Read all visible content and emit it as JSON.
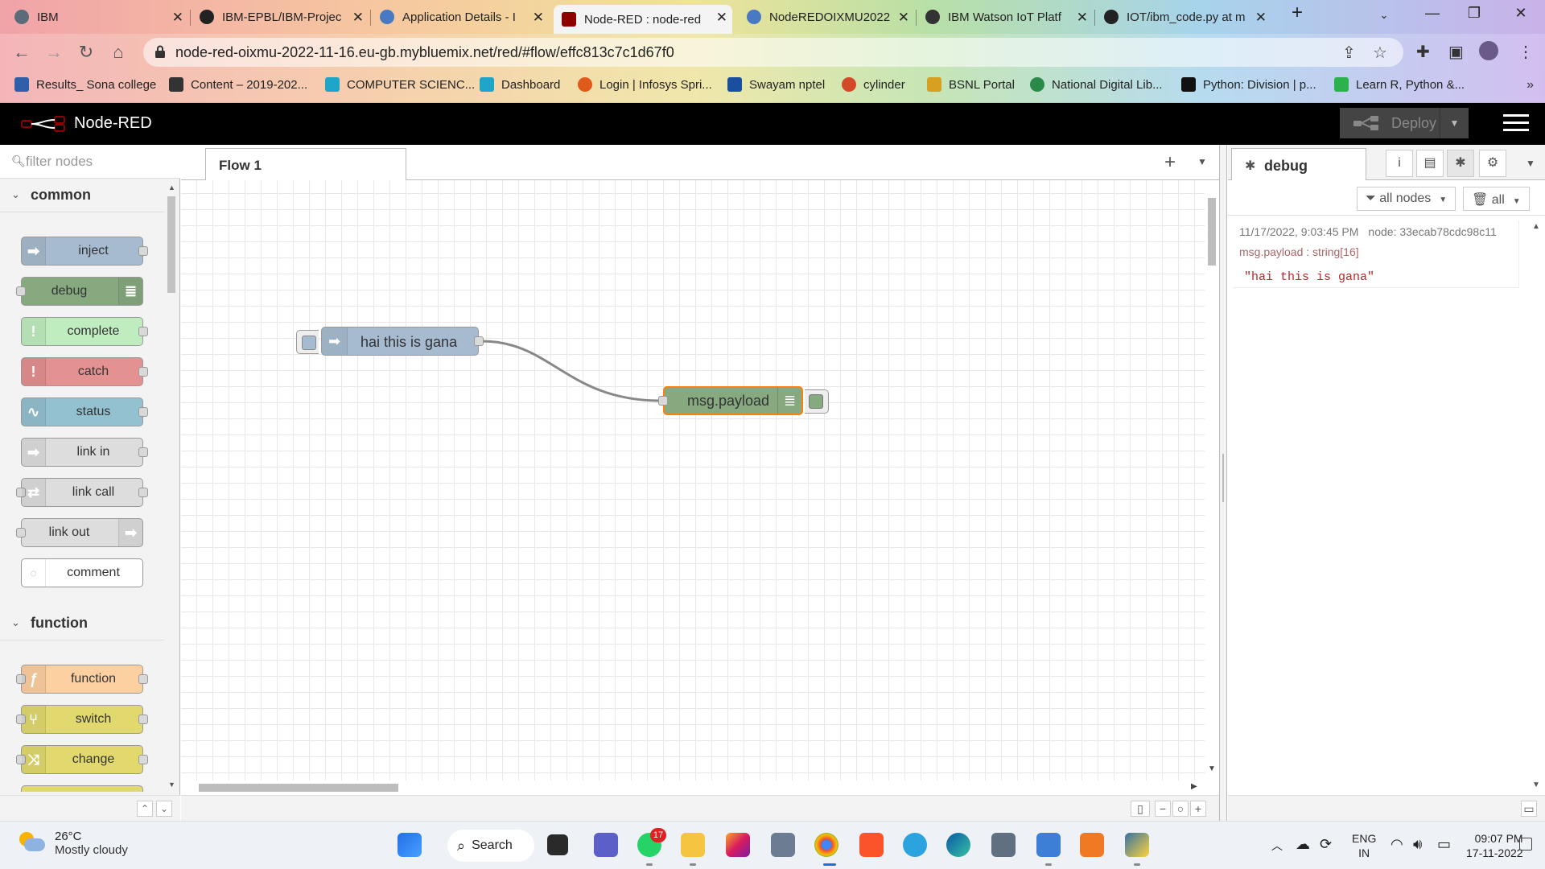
{
  "browser": {
    "tabs": [
      {
        "title": "IBM",
        "color": "#5b6b7a"
      },
      {
        "title": "IBM-EPBL/IBM-Projec",
        "color": "#222222"
      },
      {
        "title": "Application Details - I",
        "color": "#4a79c4"
      },
      {
        "title": "Node-RED : node-red",
        "color": "#8f0000"
      },
      {
        "title": "NodeREDOIXMU2022",
        "color": "#4a79c4"
      },
      {
        "title": "IBM Watson IoT Platf",
        "color": "#333333"
      },
      {
        "title": "IOT/ibm_code.py at m",
        "color": "#222222"
      }
    ],
    "url": "node-red-oixmu-2022-11-16.eu-gb.mybluemix.net/red/#flow/effc813c7c1d67f0",
    "bookmarks": [
      {
        "label": "Results_ Sona college",
        "color": "#2e5fa8"
      },
      {
        "label": "Content – 2019-202...",
        "color": "#333333"
      },
      {
        "label": "COMPUTER SCIENC...",
        "color": "#1ea5c8"
      },
      {
        "label": "Dashboard",
        "color": "#1ea5c8"
      },
      {
        "label": "Login | Infosys Spri...",
        "color": "#e05a1a"
      },
      {
        "label": "Swayam nptel",
        "color": "#1a4fa0"
      },
      {
        "label": "cylinder",
        "color": "#d24a2a"
      },
      {
        "label": "BSNL Portal",
        "color": "#d8a020"
      },
      {
        "label": "National Digital Lib...",
        "color": "#2a8a4a"
      },
      {
        "label": "Python: Division | p...",
        "color": "#111111"
      },
      {
        "label": "Learn R, Python &...",
        "color": "#2bb24c"
      }
    ]
  },
  "app": {
    "title": "Node-RED",
    "deploy_label": "Deploy"
  },
  "palette": {
    "search_placeholder": "filter nodes",
    "categories": [
      {
        "label": "common",
        "nodes": [
          {
            "label": "inject",
            "color": "#a6bbcf",
            "icon": "arrow-right-icon",
            "glyph": "➡"
          },
          {
            "label": "debug",
            "color": "#87a980",
            "icon": "list-icon",
            "glyph": "≣"
          },
          {
            "label": "complete",
            "color": "#c0edc0",
            "icon": "exclamation-icon",
            "glyph": "!"
          },
          {
            "label": "catch",
            "color": "#e49191",
            "icon": "exclamation-icon",
            "glyph": "!"
          },
          {
            "label": "status",
            "color": "#94c1d0",
            "icon": "pulse-icon",
            "glyph": "∿"
          },
          {
            "label": "link in",
            "color": "#dddddd",
            "icon": "link-in-icon",
            "glyph": "➡"
          },
          {
            "label": "link call",
            "color": "#dddddd",
            "icon": "link-call-icon",
            "glyph": "⇄"
          },
          {
            "label": "link out",
            "color": "#dddddd",
            "icon": "link-out-icon",
            "glyph": "➡"
          },
          {
            "label": "comment",
            "color": "#ffffff",
            "icon": "comment-icon",
            "glyph": "💬"
          }
        ]
      },
      {
        "label": "function",
        "nodes": [
          {
            "label": "function",
            "color": "#fdd0a2",
            "icon": "function-icon",
            "glyph": "ƒ"
          },
          {
            "label": "switch",
            "color": "#e2d96e",
            "icon": "switch-icon",
            "glyph": "⑂"
          },
          {
            "label": "change",
            "color": "#e2d96e",
            "icon": "change-icon",
            "glyph": "⤨"
          }
        ]
      }
    ]
  },
  "workspace": {
    "flow_tab": "Flow 1",
    "inject_node_label": "hai this is gana",
    "debug_node_label": "msg.payload"
  },
  "sidebar": {
    "tab_label": "debug",
    "filter_nodes": "all nodes",
    "clear_label": "all",
    "message": {
      "timestamp": "11/17/2022, 9:03:45 PM",
      "node": "node: 33ecab78cdc98c11",
      "topic": "msg.payload : string[16]",
      "value": "\"hai this is gana\""
    }
  },
  "taskbar": {
    "temperature": "26°C",
    "condition": "Mostly cloudy",
    "search_label": "Search",
    "whatsapp_badge": "17",
    "lang_top": "ENG",
    "lang_bottom": "IN",
    "time": "09:07 PM",
    "date": "17-11-2022"
  }
}
